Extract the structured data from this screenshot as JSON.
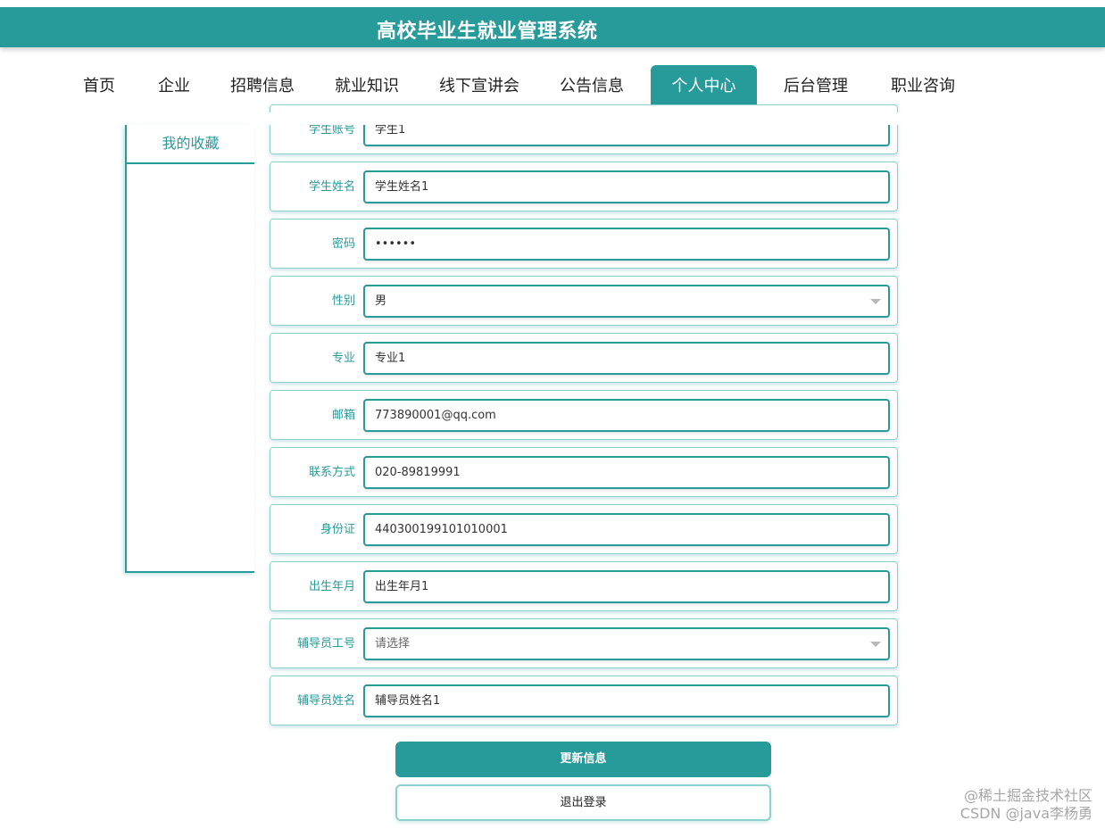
{
  "header": {
    "title": "高校毕业生就业管理系统"
  },
  "nav": {
    "items": [
      {
        "label": "首页"
      },
      {
        "label": "企业"
      },
      {
        "label": "招聘信息"
      },
      {
        "label": "就业知识"
      },
      {
        "label": "线下宣讲会"
      },
      {
        "label": "公告信息"
      },
      {
        "label": "个人中心",
        "active": true
      },
      {
        "label": "后台管理"
      },
      {
        "label": "职业咨询"
      }
    ]
  },
  "sidebar": {
    "items": [
      {
        "label": "我的收藏"
      }
    ]
  },
  "form": {
    "fields": [
      {
        "label": "学生账号",
        "value": "学生1"
      },
      {
        "label": "学生姓名",
        "value": "学生姓名1"
      },
      {
        "label": "密码",
        "value": "••••••"
      },
      {
        "label": "性别",
        "value": "男",
        "type": "select"
      },
      {
        "label": "专业",
        "value": "专业1"
      },
      {
        "label": "邮箱",
        "value": "773890001@qq.com"
      },
      {
        "label": "联系方式",
        "value": "020-89819991"
      },
      {
        "label": "身份证",
        "value": "440300199101010001"
      },
      {
        "label": "出生年月",
        "value": "出生年月1"
      },
      {
        "label": "辅导员工号",
        "value": "请选择",
        "type": "select"
      },
      {
        "label": "辅导员姓名",
        "value": "辅导员姓名1"
      }
    ]
  },
  "actions": {
    "update_label": "更新信息",
    "logout_label": "退出登录"
  },
  "watermark": {
    "line1": "@稀土掘金技术社区",
    "line2": "CSDN @java李杨勇"
  },
  "colors": {
    "accent": "#279a9a",
    "border_light": "#8fcfcf"
  }
}
